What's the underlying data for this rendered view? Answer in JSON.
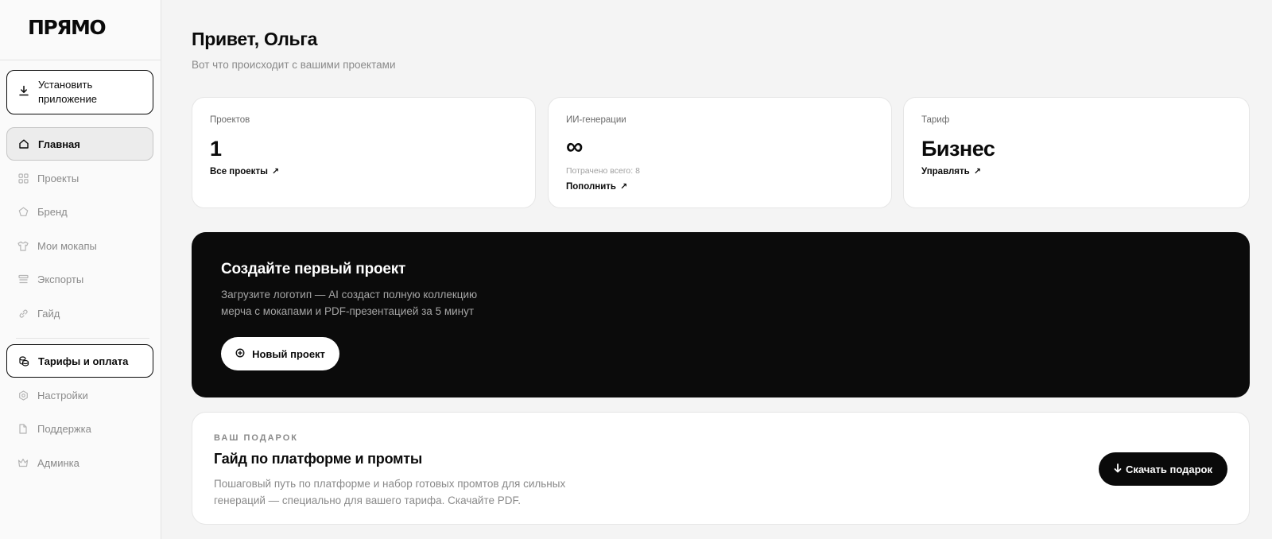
{
  "brand": {
    "logo": "ПРЯМО"
  },
  "sidebar": {
    "install": {
      "label": "Установить приложение",
      "icon": "download-icon"
    },
    "items": [
      {
        "label": "Главная",
        "icon": "home-icon",
        "state": "active"
      },
      {
        "label": "Проекты",
        "icon": "grid-icon"
      },
      {
        "label": "Бренд",
        "icon": "pentagon-icon"
      },
      {
        "label": "Мои мокапы",
        "icon": "tshirt-icon"
      },
      {
        "label": "Экспорты",
        "icon": "stack-icon"
      },
      {
        "label": "Гайд",
        "icon": "link-icon"
      },
      {
        "label": "Тарифы и оплата",
        "icon": "coins-icon",
        "state": "outlined"
      },
      {
        "label": "Настройки",
        "icon": "gear-icon"
      },
      {
        "label": "Поддержка",
        "icon": "document-icon"
      },
      {
        "label": "Админка",
        "icon": "crown-icon"
      }
    ]
  },
  "header": {
    "greeting": "Привет, Ольга",
    "subtitle": "Вот что происходит с вашими проектами"
  },
  "stats": [
    {
      "label": "Проектов",
      "value": "1",
      "link": "Все проекты"
    },
    {
      "label": "ИИ-генерации",
      "value": "∞",
      "note": "Потрачено всего: 8",
      "link": "Пополнить"
    },
    {
      "label": "Тариф",
      "value": "Бизнес",
      "link": "Управлять"
    }
  ],
  "hero": {
    "title": "Создайте первый проект",
    "description": "Загрузите логотип — AI создаст полную коллекцию мерча с мокапами и PDF-презентацией за 5 минут",
    "cta": "Новый проект",
    "colors": {
      "background": "#0b0b0b",
      "button": "#ffffff"
    }
  },
  "gift": {
    "eyebrow": "ВАШ ПОДАРОК",
    "title": "Гайд по платформе и промты",
    "description": "Пошаговый путь по платформе и набор готовых промтов для сильных генераций — специально для вашего тарифа. Скачайте PDF.",
    "button": "Скачать подарок"
  }
}
